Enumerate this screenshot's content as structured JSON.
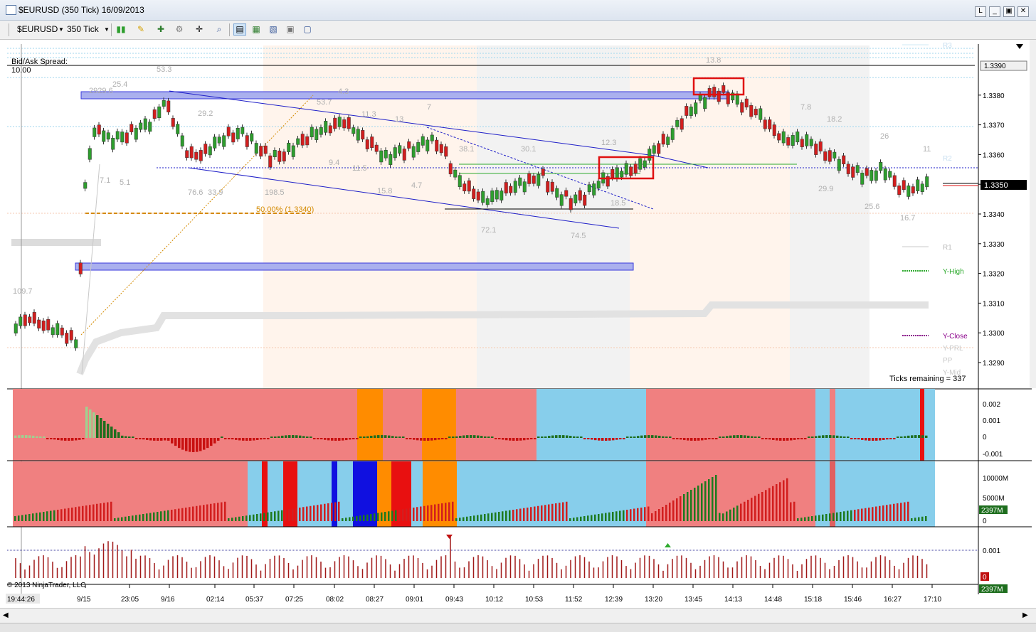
{
  "window": {
    "title": "$EURUSD (350 Tick)  16/09/2013",
    "btn_l": "L",
    "btn_min": "_",
    "btn_max": "▣",
    "btn_close": "✕"
  },
  "toolbar": {
    "instrument": "$EURUSD",
    "interval": "350 Tick"
  },
  "panel": {
    "spread_label": "Bid/Ask Spread:",
    "spread_value": "10.00",
    "fib_label": "50.00% (1.3340)",
    "ticks_remaining": "Ticks remaining = 337",
    "copyright": "© 2013 NinjaTrader, LLC",
    "time_start": "19:44:26"
  },
  "colors": {
    "up_candle": "#2e9e2e",
    "down_candle": "#d21e1e",
    "zone": "#aab0ee",
    "ind_red": "#f08080",
    "ind_blue": "#87ceeb",
    "ind_orange": "#ff8c00"
  },
  "chart_data": {
    "type": "candlestick",
    "price_axis": [
      "1.3390",
      "1.3380",
      "1.3370",
      "1.3360",
      "1.3350",
      "1.3340",
      "1.3330",
      "1.3320",
      "1.3310",
      "1.3300",
      "1.3290"
    ],
    "current_price": "1.3350",
    "last_label": "1.3390",
    "time_axis": [
      "9/15",
      "23:05",
      "9/16",
      "02:14",
      "05:37",
      "07:25",
      "08:02",
      "08:27",
      "09:01",
      "09:43",
      "10:12",
      "10:53",
      "11:52",
      "12:39",
      "13:20",
      "13:45",
      "14:13",
      "14:48",
      "15:18",
      "15:46",
      "16:27",
      "17:10"
    ],
    "price_annotations": [
      "2929.6",
      "25.4",
      "53.3",
      "29.2",
      "53.7",
      "4.3",
      "11.3",
      "13",
      "7",
      "7.1",
      "5.1",
      "76.6",
      "33.9",
      "198.5",
      "9.4",
      "11.5",
      "15.8",
      "4.7",
      "38.1",
      "30.1",
      "12.3",
      "18.5",
      "72.1",
      "74.5",
      "13.8",
      "7.8",
      "18.2",
      "26",
      "11",
      "29.9",
      "25.6",
      "16.7",
      "109.7"
    ],
    "level_labels": [
      "R3",
      "R2",
      "R1",
      "Y-High",
      "Y-Close",
      "Y-PRL",
      "PP",
      "Y-Mid"
    ],
    "indicator1_axis": [
      "0.002",
      "0.001",
      "0",
      "-0.001"
    ],
    "indicator2_axis": [
      "10000M",
      "5000M",
      "2397M",
      "0"
    ],
    "indicator3_axis": [
      "0.001",
      "0",
      "2397M"
    ]
  }
}
